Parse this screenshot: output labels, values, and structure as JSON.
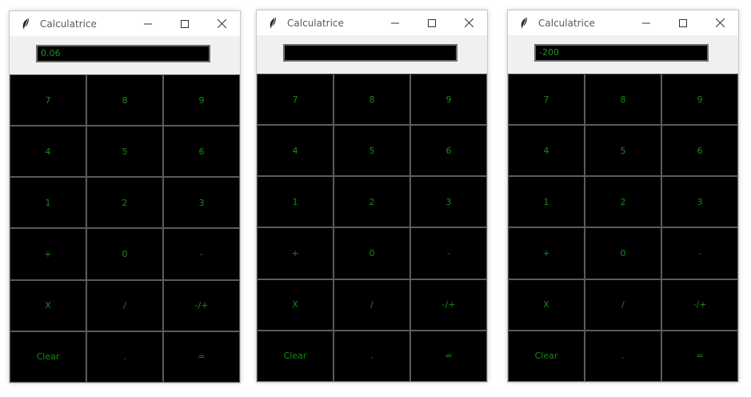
{
  "windows": [
    {
      "title": "Calculatrice",
      "display_value": "0.06",
      "keys": [
        "7",
        "8",
        "9",
        "4",
        "5",
        "6",
        "1",
        "2",
        "3",
        "+",
        "0",
        "-",
        "X",
        "/",
        "-/+",
        "Clear",
        ".",
        "="
      ]
    },
    {
      "title": "Calculatrice",
      "display_value": "",
      "keys": [
        "7",
        "8",
        "9",
        "4",
        "5",
        "6",
        "1",
        "2",
        "3",
        "+",
        "0",
        "-",
        "X",
        "/",
        "-/+",
        "Clear",
        ".",
        "="
      ]
    },
    {
      "title": "Calculatrice",
      "display_value": "-200",
      "keys": [
        "7",
        "8",
        "9",
        "4",
        "5",
        "6",
        "1",
        "2",
        "3",
        "+",
        "0",
        "-",
        "X",
        "/",
        "-/+",
        "Clear",
        ".",
        "="
      ]
    }
  ],
  "colors": {
    "key_text": "#178a17",
    "key_bg": "#000000",
    "display_bg": "#000000",
    "display_text": "#2a8a2a",
    "titlebar_bg": "#ffffff"
  },
  "icons": [
    "feather-icon",
    "minimize-icon",
    "maximize-icon",
    "close-icon"
  ]
}
